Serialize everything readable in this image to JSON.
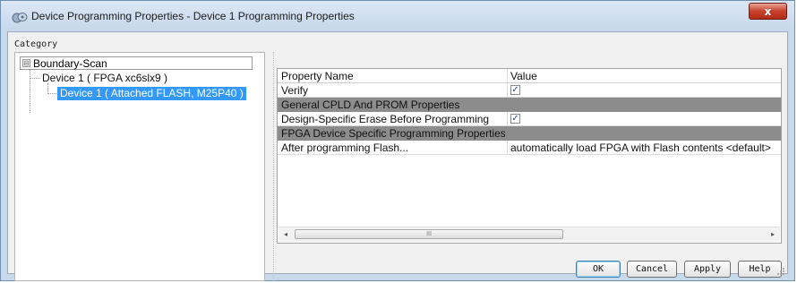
{
  "window": {
    "title": "Device Programming Properties - Device 1 Programming Properties",
    "close_label": "x"
  },
  "category": {
    "label": "Category",
    "tree": {
      "root": "Boundary-Scan",
      "expander": "⊟",
      "items": [
        "Device 1 ( FPGA xc6slx9 )",
        "Device 1 ( Attached FLASH, M25P40 )"
      ],
      "selected_index": 1
    }
  },
  "properties": {
    "header": {
      "name": "Property Name",
      "value": "Value"
    },
    "rows": [
      {
        "name": "Verify",
        "value": "",
        "checked": true
      },
      {
        "name": "General CPLD And PROM Properties",
        "section": true
      },
      {
        "name": "Design-Specific Erase Before Programming",
        "value": "",
        "checked": true
      },
      {
        "name": "FPGA Device Specific Programming Properties",
        "section": true
      },
      {
        "name": "After programming Flash...",
        "value": "automatically load FPGA with Flash contents <default>"
      }
    ],
    "check_glyph": "✓",
    "scroll_left": "◂",
    "scroll_right": "▸",
    "scroll_grip": "III"
  },
  "buttons": {
    "ok": "OK",
    "cancel": "Cancel",
    "apply": "Apply",
    "help": "Help"
  },
  "colors": {
    "selection": "#3399ff",
    "section_row": "#8c8c8c",
    "close_button": "#c6402b"
  }
}
